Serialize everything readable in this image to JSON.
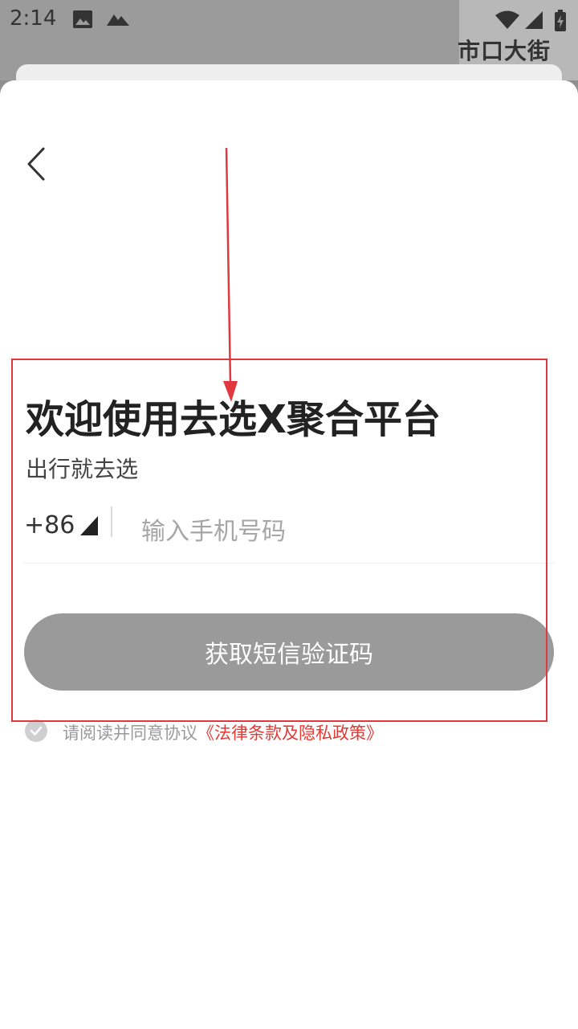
{
  "status_bar": {
    "time": "2:14",
    "map_text": "市口大街",
    "icons": [
      "image-icon",
      "mountain-icon",
      "wifi-icon",
      "signal-icon",
      "battery-icon"
    ]
  },
  "login": {
    "title": "欢迎使用去选X聚合平台",
    "subtitle": "出行就去选",
    "country_code": "+86",
    "phone_placeholder": "输入手机号码",
    "sms_button": "获取短信验证码",
    "agreement_prefix": "请阅读并同意协议",
    "agreement_link": "《法律条款及隐私政策》"
  },
  "colors": {
    "sheet_background": "#ffffff",
    "button_disabled": "#9a9a9a",
    "link_red": "#e53935",
    "annotation_red": "#e0383e"
  }
}
